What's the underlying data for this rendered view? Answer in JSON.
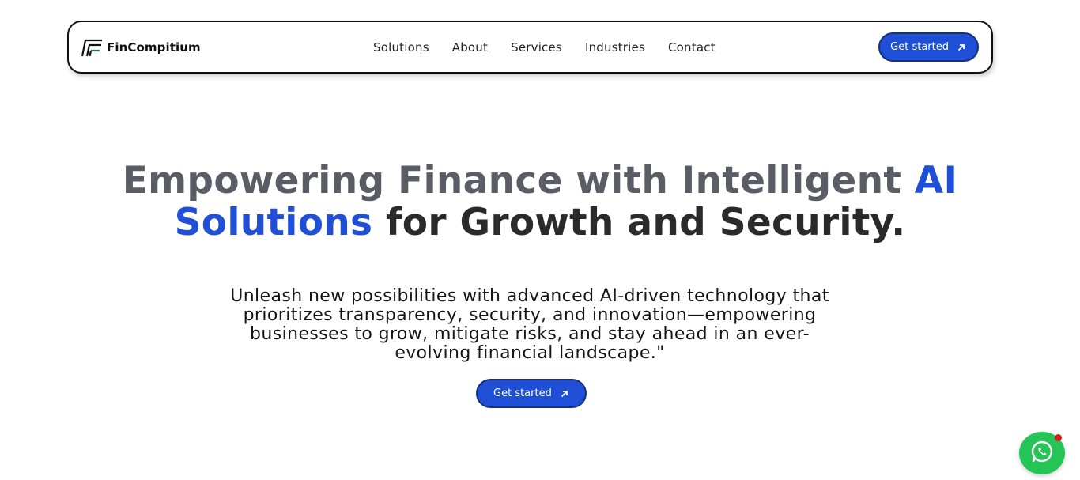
{
  "brand": {
    "name": "FinCompitium",
    "logo_icon": "fincompitium-logo-icon"
  },
  "nav": {
    "links": [
      "Solutions",
      "About",
      "Services",
      "Industries",
      "Contact"
    ],
    "cta_label": "Get started"
  },
  "hero": {
    "title_part1": "Empowering Finance with Intelligent ",
    "title_accent1": "AI",
    "title_accent2": "Solutions",
    "title_part2": " for Growth and Security.",
    "subtitle": "Unleash new possibilities with advanced AI-driven technology that prioritizes transparency, security, and innovation—empowering businesses to grow, mitigate risks, and stay ahead in an ever-evolving financial landscape.\"",
    "cta_label": "Get started"
  },
  "chat_widget": {
    "icon": "whatsapp-icon",
    "has_notification": true
  },
  "colors": {
    "accent": "#1e4fd6",
    "whatsapp": "#25c456",
    "notification": "#d61c1c"
  }
}
